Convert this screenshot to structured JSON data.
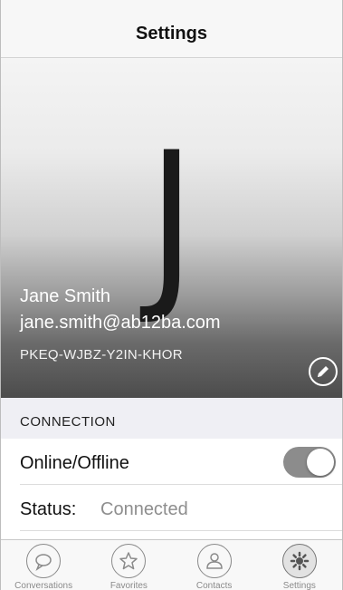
{
  "navbar": {
    "title": "Settings"
  },
  "profile": {
    "initial": "J",
    "name": "Jane Smith",
    "email": "jane.smith@ab12ba.com",
    "key": "PKEQ-WJBZ-Y2IN-KHOR",
    "edit_icon": "pencil-icon"
  },
  "connection": {
    "header": "CONNECTION",
    "online_label": "Online/Offline",
    "online_enabled": true,
    "status_label": "Status:",
    "status_value": "Connected"
  },
  "tabs": [
    {
      "label": "Conversations",
      "icon": "chat-bubble-icon",
      "active": false
    },
    {
      "label": "Favorites",
      "icon": "star-icon",
      "active": false
    },
    {
      "label": "Contacts",
      "icon": "person-icon",
      "active": false
    },
    {
      "label": "Settings",
      "icon": "gear-icon",
      "active": true
    }
  ],
  "colors": {
    "toggle_on": "#8c8c8c",
    "tab_inactive": "#8a8a8a"
  }
}
